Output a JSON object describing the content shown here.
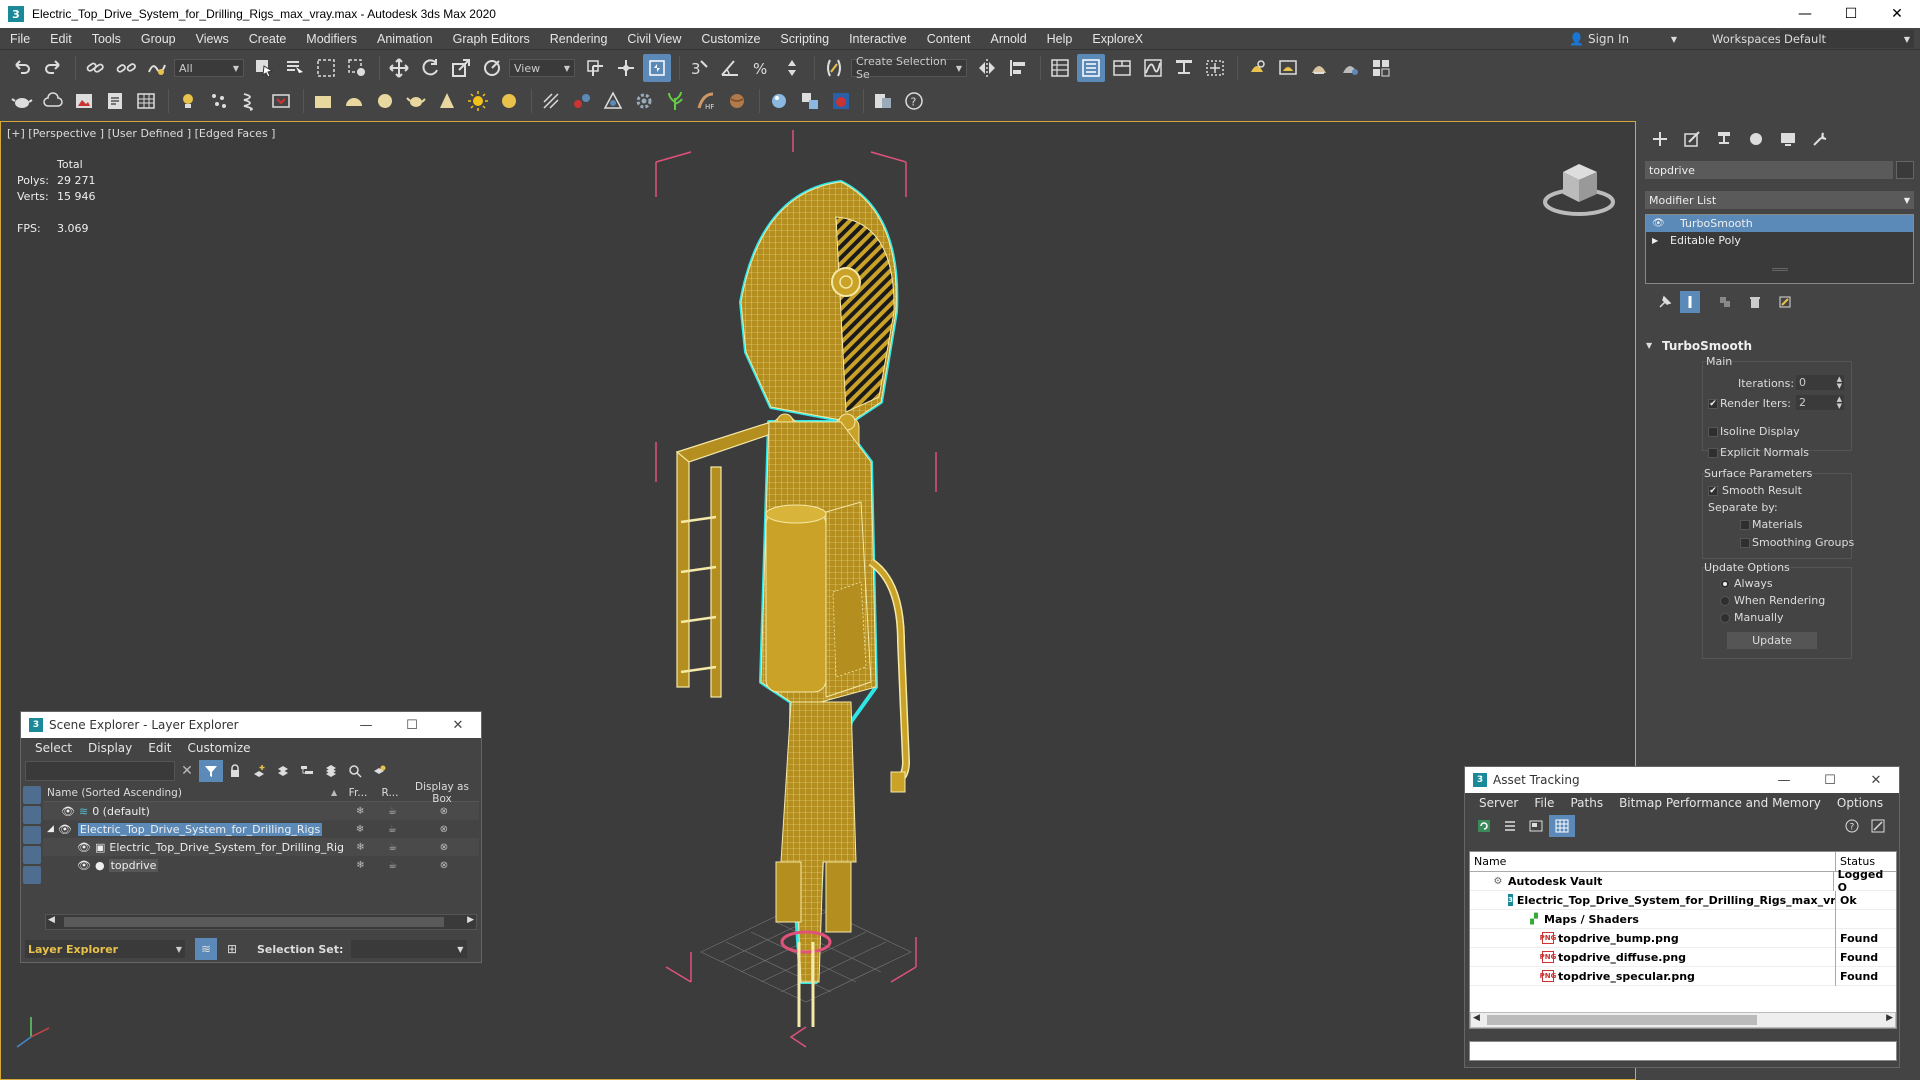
{
  "window": {
    "title": "Electric_Top_Drive_System_for_Drilling_Rigs_max_vray.max - Autodesk 3ds Max 2020",
    "app_icon_letter": "3"
  },
  "menu": {
    "items": [
      "File",
      "Edit",
      "Tools",
      "Group",
      "Views",
      "Create",
      "Modifiers",
      "Animation",
      "Graph Editors",
      "Rendering",
      "Civil View",
      "Customize",
      "Scripting",
      "Interactive",
      "Content",
      "Arnold",
      "Help",
      "ExploreX"
    ],
    "sign_in": "Sign In",
    "workspaces_label": "Workspaces:",
    "workspace_value": "Default"
  },
  "toolbar": {
    "filter_value": "All",
    "ref_coord_value": "View",
    "selection_set_placeholder": "Create Selection Se"
  },
  "viewport": {
    "label": "[+] [Perspective ] [User Defined ] [Edged Faces ]",
    "stats": {
      "total_label": "Total",
      "polys_label": "Polys:",
      "polys_value": "29 271",
      "verts_label": "Verts:",
      "verts_value": "15 946",
      "fps_label": "FPS:",
      "fps_value": "3.069"
    },
    "colors": {
      "model": "#c9a227",
      "wire": "#f5e9a8",
      "outline": "#2ee6e6",
      "bbox": "#e0527a"
    }
  },
  "command_panel": {
    "object_name": "topdrive",
    "modifier_list_label": "Modifier List",
    "stack": [
      "TurboSmooth",
      "Editable Poly"
    ],
    "rollout_title": "TurboSmooth",
    "main_group": "Main",
    "iterations_label": "Iterations:",
    "iterations_value": "0",
    "render_iters_label": "Render Iters:",
    "render_iters_value": "2",
    "render_iters_checked": true,
    "isoline_label": "Isoline Display",
    "explicit_normals_label": "Explicit Normals",
    "surface_group": "Surface Parameters",
    "smooth_result_label": "Smooth Result",
    "separate_by_label": "Separate by:",
    "materials_label": "Materials",
    "smoothing_groups_label": "Smoothing Groups",
    "update_group": "Update Options",
    "always_label": "Always",
    "when_rendering_label": "When Rendering",
    "manually_label": "Manually",
    "update_button": "Update",
    "selected_color": "#5b8ab8"
  },
  "scene_explorer": {
    "title": "Scene Explorer - Layer Explorer",
    "menu": [
      "Select",
      "Display",
      "Edit",
      "Customize"
    ],
    "columns": {
      "name": "Name (Sorted Ascending)",
      "sort_arrow": "▲",
      "frozen": "Fr...",
      "renderable": "R...",
      "display_as_box": "Display as Box"
    },
    "rows": [
      {
        "name": "0 (default)"
      },
      {
        "name": "Electric_Top_Drive_System_for_Drilling_Rigs"
      },
      {
        "name": "Electric_Top_Drive_System_for_Drilling_Rigs"
      },
      {
        "name": "topdrive"
      }
    ],
    "layer_explorer_label": "Layer Explorer",
    "selection_set_label": "Selection Set:"
  },
  "asset_tracking": {
    "title": "Asset Tracking",
    "menu": [
      "Server",
      "File",
      "Paths",
      "Bitmap Performance and Memory",
      "Options"
    ],
    "columns": {
      "name": "Name",
      "status": "Status"
    },
    "rows": [
      {
        "name": "Autodesk Vault",
        "status": "Logged O"
      },
      {
        "name": "Electric_Top_Drive_System_for_Drilling_Rigs_max_vray.max",
        "status": "Ok"
      },
      {
        "name": "Maps / Shaders",
        "status": ""
      },
      {
        "name": "topdrive_bump.png",
        "status": "Found"
      },
      {
        "name": "topdrive_diffuse.png",
        "status": "Found"
      },
      {
        "name": "topdrive_specular.png",
        "status": "Found"
      }
    ],
    "png_badge": "PNG"
  }
}
